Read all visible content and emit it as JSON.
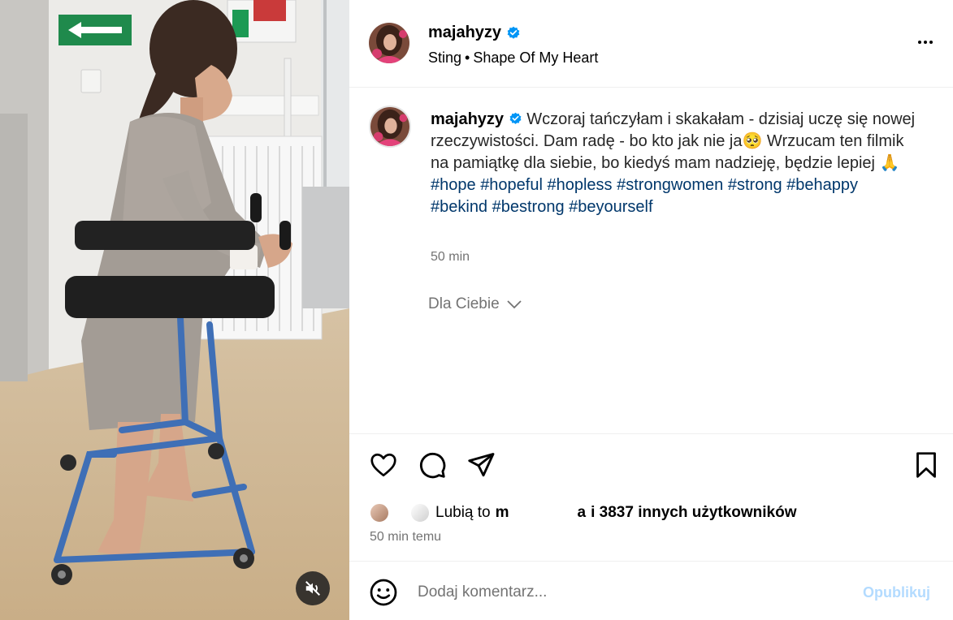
{
  "media": {
    "mute_icon": "speaker-muted-icon"
  },
  "header": {
    "username": "majahyzy",
    "verified_icon": "verified-badge-icon",
    "audio_artist": "Sting",
    "audio_separator": "•",
    "audio_track": "Shape Of My Heart",
    "more_icon": "more-options-icon"
  },
  "caption": {
    "username": "majahyzy",
    "text": "Wczoraj tańczyłam i skakałam - dzisiaj uczę się nowej rzeczywistości. Dam radę - bo kto jak nie ja🥺 Wrzucam ten filmik na pamiątkę dla siebie, bo kiedyś mam nadzieję, będzie lepiej 🙏",
    "hashtags": [
      "#hope",
      "#hopeful",
      "#hopless",
      "#strongwomen",
      "#strong",
      "#behappy",
      "#bekind",
      "#bestrong",
      "#beyourself"
    ],
    "time": "50 min",
    "for_you_label": "Dla Ciebie"
  },
  "actions": {
    "like_icon": "heart-icon",
    "comment_icon": "comment-icon",
    "share_icon": "share-icon",
    "save_icon": "bookmark-icon",
    "likes_prefix": "Lubią to",
    "likes_user_start": "m",
    "likes_user_end": "a",
    "likes_suffix": "i 3837 innych użytkowników",
    "post_time": "50 min temu"
  },
  "comment": {
    "emoji_icon": "emoji-icon",
    "placeholder": "Dodaj komentarz...",
    "publish_label": "Opublikuj"
  },
  "colors": {
    "hashtag": "#00376b",
    "verified": "#0095f6",
    "publish_disabled": "#b3dbff",
    "muted_text": "#737373"
  }
}
